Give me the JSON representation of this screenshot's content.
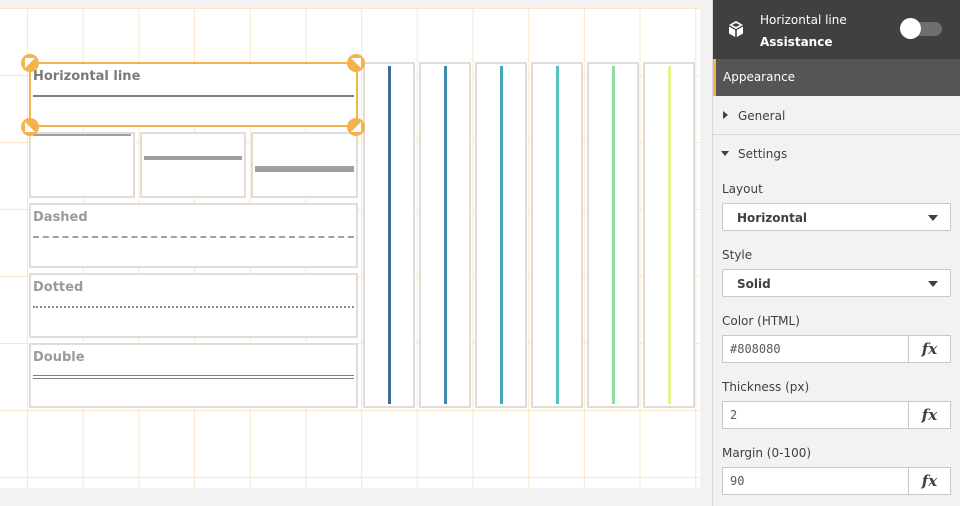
{
  "canvas": {
    "selected": {
      "title": "Horizontal line"
    },
    "dashed": {
      "title": "Dashed"
    },
    "dotted": {
      "title": "Dotted"
    },
    "double": {
      "title": "Double"
    },
    "vertical_line_colors": [
      "#3d6c95",
      "#3f8bab",
      "#45a7b9",
      "#57c2c0",
      "#8fdca4",
      "#e0f58b"
    ],
    "line_color": "#808080",
    "accent": "#f3b34d"
  },
  "panel": {
    "header": {
      "title": "Horizontal line",
      "subtitle": "Assistance",
      "icon": "cube-icon",
      "toggle_on": false
    },
    "appearance": {
      "label": "Appearance"
    },
    "general": {
      "label": "General",
      "expanded": false
    },
    "settings": {
      "label": "Settings",
      "expanded": true
    },
    "layout": {
      "label": "Layout",
      "value": "Horizontal"
    },
    "style": {
      "label": "Style",
      "value": "Solid"
    },
    "color": {
      "label": "Color (HTML)",
      "value": "#808080",
      "fx": "fx"
    },
    "thickness": {
      "label": "Thickness (px)",
      "value": "2",
      "fx": "fx"
    },
    "margin": {
      "label": "Margin (0-100)",
      "value": "90",
      "fx": "fx"
    }
  }
}
